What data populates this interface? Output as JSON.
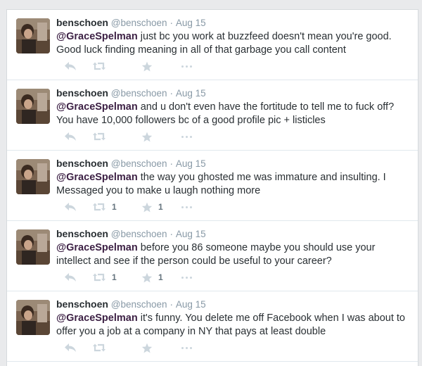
{
  "tweets": [
    {
      "fullname": "benschoen",
      "username": "@benschoen",
      "separator": "·",
      "time": "Aug 15",
      "mention": "@GraceSpelman",
      "text": " just bc you work at buzzfeed doesn't mean you're good. Good luck finding meaning in all of that garbage you call content",
      "retweet_count": "",
      "favorite_count": ""
    },
    {
      "fullname": "benschoen",
      "username": "@benschoen",
      "separator": "·",
      "time": "Aug 15",
      "mention": "@GraceSpelman",
      "text": " and u don't even have the fortitude to tell me to fuck off? You have 10,000 followers bc of a good profile pic + listicles",
      "retweet_count": "",
      "favorite_count": ""
    },
    {
      "fullname": "benschoen",
      "username": "@benschoen",
      "separator": "·",
      "time": "Aug 15",
      "mention": "@GraceSpelman",
      "text": " the way you ghosted me was immature and insulting. I Messaged you to make u laugh nothing more",
      "retweet_count": "1",
      "favorite_count": "1"
    },
    {
      "fullname": "benschoen",
      "username": "@benschoen",
      "separator": "·",
      "time": "Aug 15",
      "mention": "@GraceSpelman",
      "text": " before you 86 someone maybe you should use your intellect and see if the person could be useful to your career?",
      "retweet_count": "1",
      "favorite_count": "1"
    },
    {
      "fullname": "benschoen",
      "username": "@benschoen",
      "separator": "·",
      "time": "Aug 15",
      "mention": "@GraceSpelman",
      "text": " it's funny. You delete me off Facebook when I was about to offer you a job at a company in NY that pays at least double",
      "retweet_count": "",
      "favorite_count": ""
    }
  ],
  "icons": {
    "reply": "reply-icon",
    "retweet": "retweet-icon",
    "favorite": "star-icon",
    "more": "more-icon"
  },
  "colors": {
    "text": "#292f33",
    "meta": "#8899a6",
    "icon": "#ccd6dd",
    "mention": "#3b1f43",
    "divider": "#e1e8ed"
  }
}
